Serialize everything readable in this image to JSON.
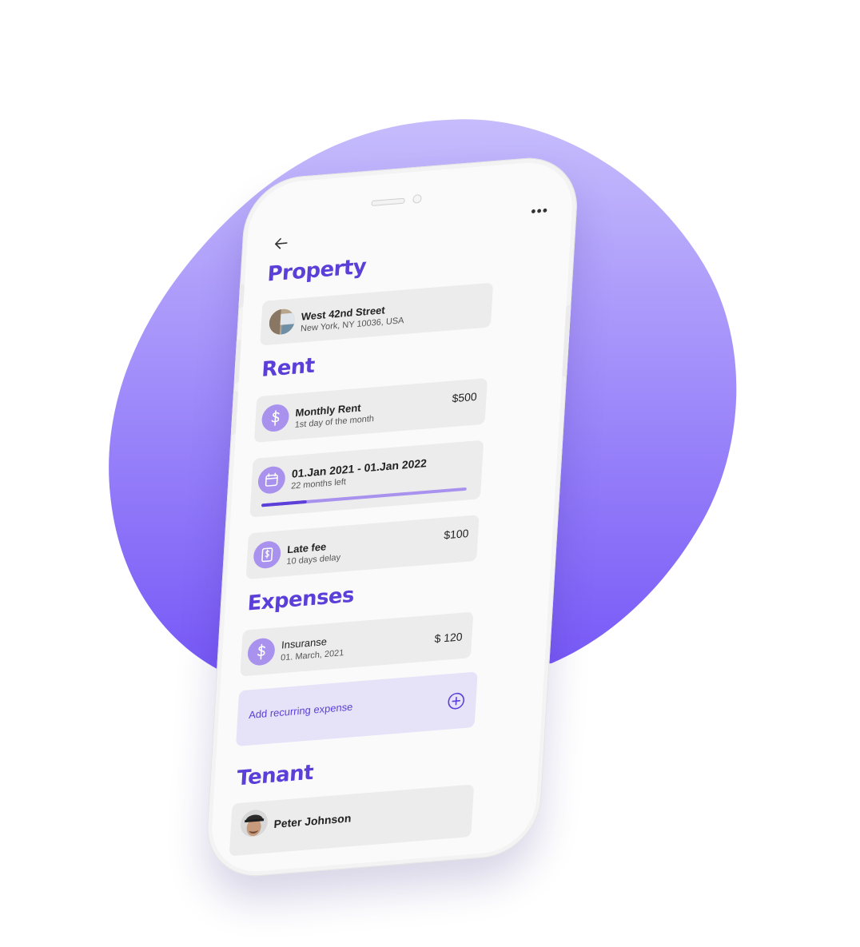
{
  "colors": {
    "accent": "#5b3fd8",
    "accent_light": "#a892ee",
    "blob_top": "#c2b6fb",
    "blob_bottom": "#7b5ef8",
    "card_bg": "#ececec"
  },
  "header": {
    "back_icon": "arrow-left-icon",
    "more_icon": "more-horizontal-icon",
    "more_glyph": "•••"
  },
  "property": {
    "title": "Property",
    "street": "West 42nd Street",
    "address": "New York, NY 10036, USA"
  },
  "rent": {
    "title": "Rent",
    "monthly": {
      "label": "Monthly Rent",
      "sub": "1st day of the month",
      "amount": "$500",
      "icon": "dollar-icon"
    },
    "period": {
      "label": "01.Jan 2021 - 01.Jan 2022",
      "sub": "22 months left",
      "icon": "calendar-icon",
      "progress": 0.22
    },
    "late_fee": {
      "label": "Late fee",
      "sub": "10 days delay",
      "amount": "$100",
      "icon": "invoice-icon"
    }
  },
  "expenses": {
    "title": "Expenses",
    "items": [
      {
        "label": "Insuranse",
        "sub": "01. March, 2021",
        "amount": "$ 120",
        "icon": "dollar-icon"
      }
    ],
    "add_label": "Add recurring expense",
    "add_icon": "plus-circle-icon"
  },
  "tenant": {
    "title": "Tenant",
    "name": "Peter Johnson"
  }
}
